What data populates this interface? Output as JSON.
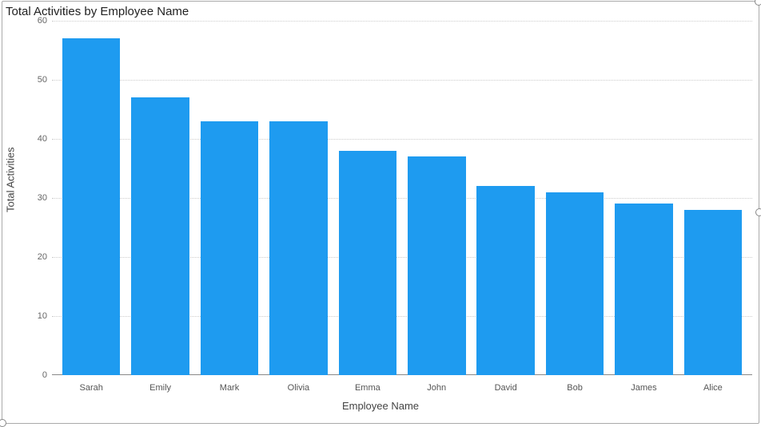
{
  "chart_data": {
    "type": "bar",
    "title": "Total Activities by Employee Name",
    "xlabel": "Employee Name",
    "ylabel": "Total Activities",
    "ylim": [
      0,
      60
    ],
    "y_ticks": [
      0,
      10,
      20,
      30,
      40,
      50,
      60
    ],
    "categories": [
      "Sarah",
      "Emily",
      "Mark",
      "Olivia",
      "Emma",
      "John",
      "David",
      "Bob",
      "James",
      "Alice"
    ],
    "values": [
      57,
      47,
      43,
      43,
      38,
      37,
      32,
      31,
      29,
      28
    ],
    "bar_color": "#1e9bf0"
  }
}
